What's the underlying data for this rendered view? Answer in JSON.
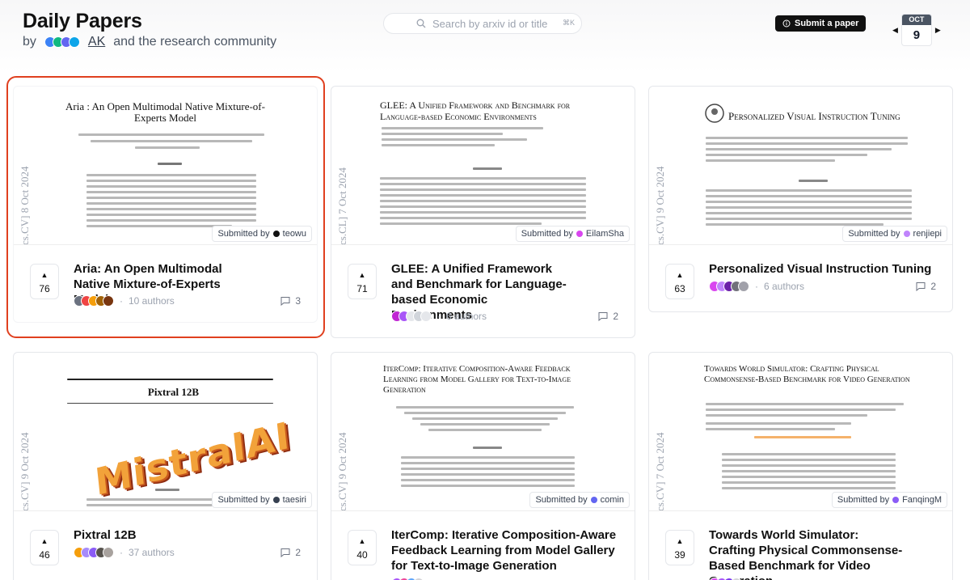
{
  "header": {
    "title": "Daily Papers",
    "by": "by",
    "ak": "AK",
    "community": "and the research community",
    "search_placeholder": "Search by arxiv id or title",
    "search_kbd": "⌘K",
    "submit_label": "Submit a paper",
    "date_month": "OCT",
    "date_day": "9"
  },
  "colors": {
    "accent_ring": "#e0401f"
  },
  "papers": [
    {
      "arxiv": "cs.CV]  8 Oct 2024",
      "paper_title": "Aria : An Open Multimodal Native Mixture-of-Experts Model",
      "submitted_label": "Submitted by",
      "submitter": "teowu",
      "votes": "76",
      "title": "Aria: An Open Multimodal Native Mixture-of-Experts Model",
      "authors": "10 authors",
      "comments": "3"
    },
    {
      "arxiv": "cs.CL]  7 Oct 2024",
      "paper_title": "GLEE: A Unified Framework and Benchmark for Language-based Economic Environments",
      "submitted_label": "Submitted by",
      "submitter": "EilamSha",
      "votes": "71",
      "title": "GLEE: A Unified Framework and Benchmark for Language-based Economic Environments",
      "authors": "6 authors",
      "comments": "2"
    },
    {
      "arxiv": "cs.CV]  9 Oct 2024",
      "paper_title": "Personalized Visual Instruction Tuning",
      "submitted_label": "Submitted by",
      "submitter": "renjiepi",
      "votes": "63",
      "title": "Personalized Visual Instruction Tuning",
      "authors": "6 authors",
      "comments": "2"
    },
    {
      "arxiv": "cs.CV]  9 Oct 2024",
      "paper_title": "Pixtral 12B",
      "logo_text": "MistralAI",
      "submitted_label": "Submitted by",
      "submitter": "taesiri",
      "votes": "46",
      "title": "Pixtral 12B",
      "authors": "37 authors",
      "comments": "2"
    },
    {
      "arxiv": "cs.CV]  9 Oct 2024",
      "paper_title": "IterComp: Iterative Composition-Aware Feedback Learning from Model Gallery for Text-to-Image Generation",
      "submitted_label": "Submitted by",
      "submitter": "comin",
      "votes": "40",
      "title": "IterComp: Iterative Composition-Aware Feedback Learning from Model Gallery for Text-to-Image Generation"
    },
    {
      "arxiv": "cs.CV]  7 Oct 2024",
      "paper_title": "Towards World Simulator: Crafting Physical Commonsense-Based Benchmark for Video Generation",
      "submitted_label": "Submitted by",
      "submitter": "FanqingM",
      "votes": "39",
      "title": "Towards World Simulator: Crafting Physical Commonsense-Based Benchmark for Video Generation"
    }
  ]
}
